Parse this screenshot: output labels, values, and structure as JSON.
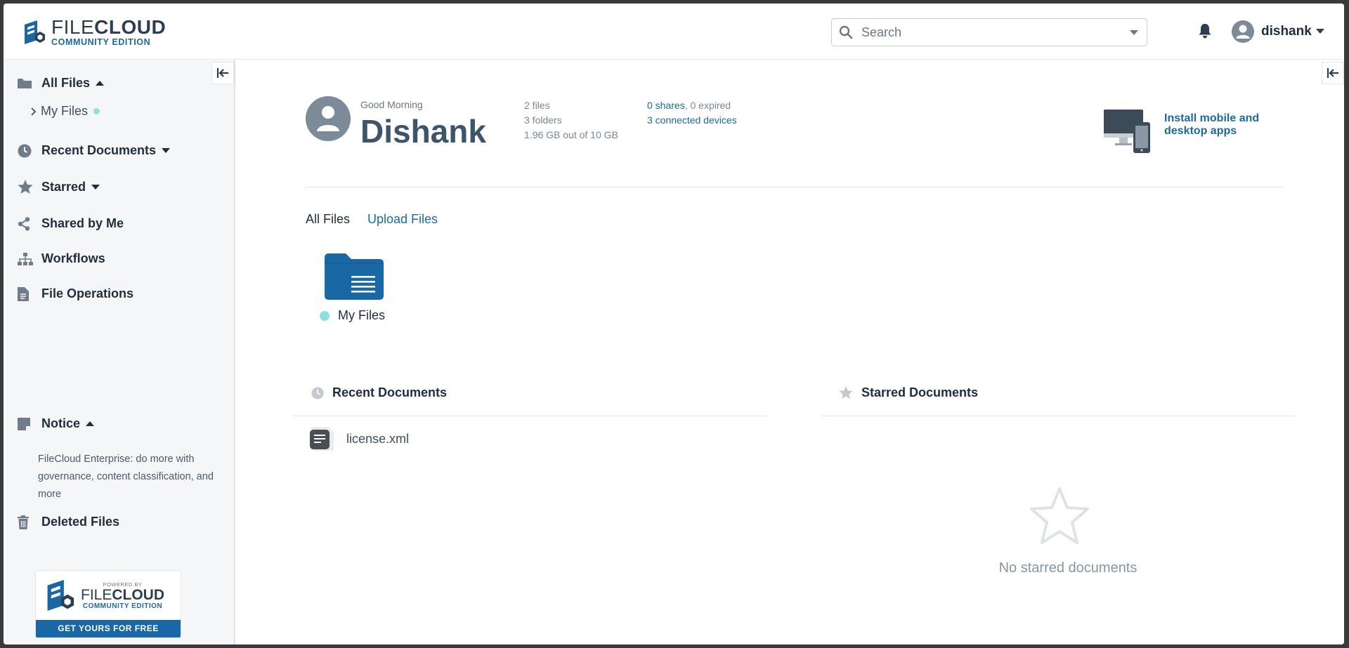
{
  "header": {
    "logo_main_light": "FILE",
    "logo_main_bold": "CLOUD",
    "logo_sub": "COMMUNITY EDITION",
    "search_placeholder": "Search",
    "user_name": "dishank"
  },
  "sidebar": {
    "all_files": "All Files",
    "my_files": "My Files",
    "recent_documents": "Recent Documents",
    "starred": "Starred",
    "shared_by_me": "Shared by Me",
    "workflows": "Workflows",
    "file_operations": "File Operations",
    "notice": "Notice",
    "notice_text": "FileCloud Enterprise: do more with governance, content classification, and more",
    "deleted_files": "Deleted Files",
    "promo": {
      "powered_by": "POWERED BY",
      "name_light": "FILE",
      "name_bold": "CLOUD",
      "edition": "COMMUNITY EDITION",
      "cta": "GET YOURS FOR FREE"
    }
  },
  "dashboard": {
    "greeting": "Good Morning",
    "name": "Dishank",
    "files_count": "2 files",
    "folders_count": "3 folders",
    "storage": "1.96 GB out of 10 GB",
    "shares": "0 shares",
    "expired": ", 0 expired",
    "devices": "3 connected devices",
    "install_apps": "Install mobile and desktop apps"
  },
  "tabs": {
    "all_files": "All Files",
    "upload_files": "Upload Files"
  },
  "folders": [
    {
      "label": "My Files"
    }
  ],
  "recent_panel": {
    "title": "Recent Documents",
    "items": [
      {
        "name": "license.xml"
      }
    ]
  },
  "starred_panel": {
    "title": "Starred Documents",
    "empty_text": "No starred documents"
  },
  "colors": {
    "accent": "#1d6aa0",
    "brand_blue": "#1a67a6",
    "status_dot": "#8fdfe0",
    "text_dark": "#1f2d3d"
  },
  "icons": {
    "search": "search-icon",
    "bell": "bell-icon",
    "user": "user-avatar-icon",
    "collapse": "collapse-left-icon",
    "folder": "folder-icon",
    "clock": "clock-icon",
    "star": "star-icon",
    "share": "share-icon",
    "workflow": "workflow-icon",
    "document": "document-icon",
    "notice": "note-icon",
    "trash": "trash-icon"
  }
}
